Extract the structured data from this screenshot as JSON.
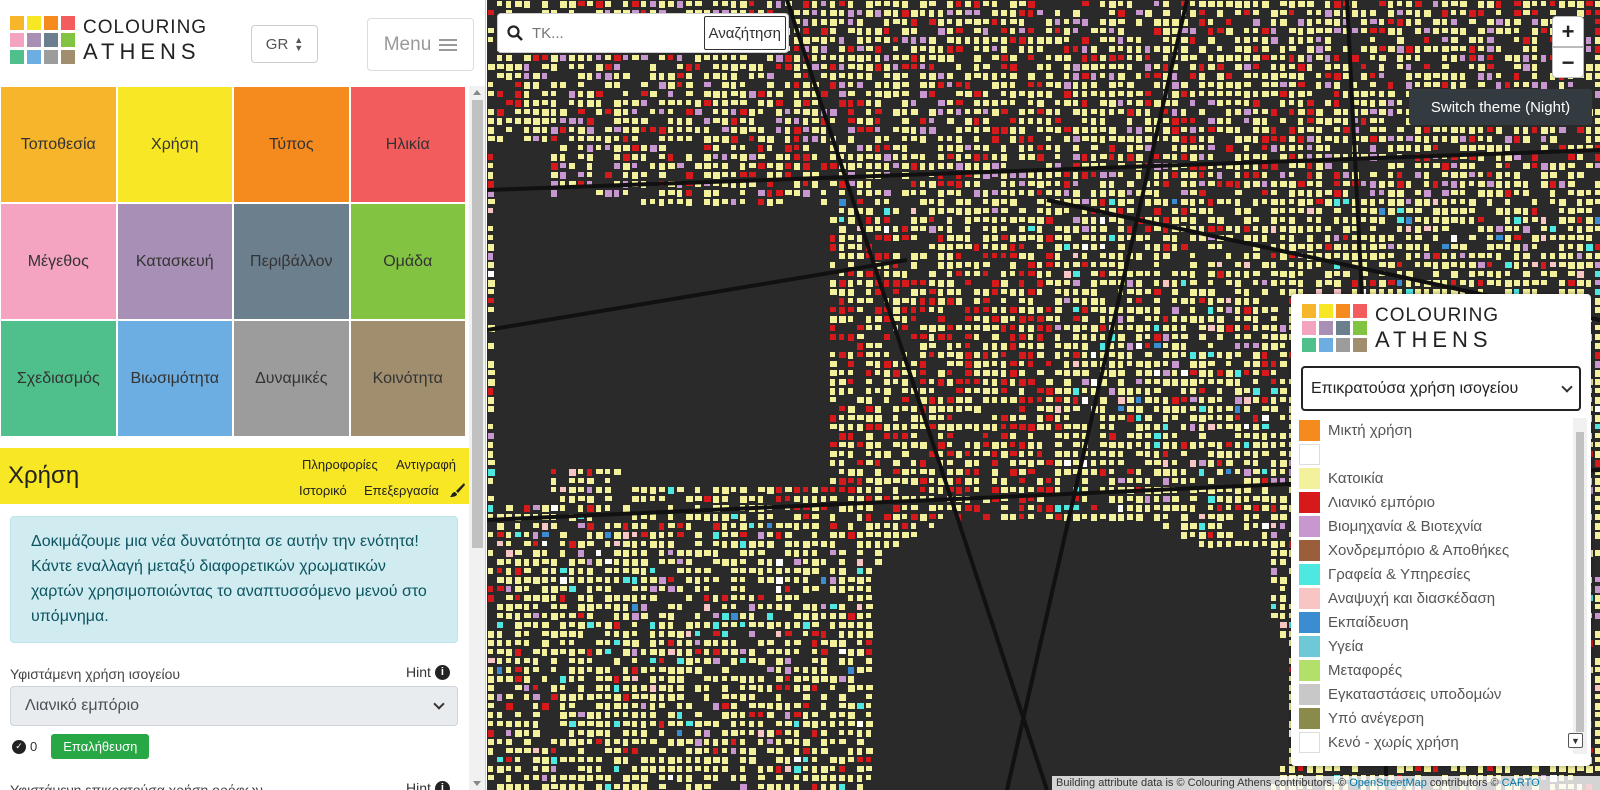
{
  "header": {
    "logo_line1": "COLOURING",
    "logo_line2": "ATHENS",
    "logo_colors": [
      "#f6b52a",
      "#f8e725",
      "#f58a1f",
      "#f25c5c",
      "#f4a3c1",
      "#a78fb5",
      "#6c7f8d",
      "#82c341",
      "#4fbf8b",
      "#6daee2",
      "#9c9c9c",
      "#a08e6f"
    ],
    "language": "GR",
    "menu_label": "Menu"
  },
  "categories": [
    {
      "label": "Τοποθεσία",
      "color": "#f6b52a"
    },
    {
      "label": "Χρήση",
      "color": "#f8e725"
    },
    {
      "label": "Τύπος",
      "color": "#f58a1f"
    },
    {
      "label": "Ηλικία",
      "color": "#f25c5c"
    },
    {
      "label": "Μέγεθος",
      "color": "#f4a3c1"
    },
    {
      "label": "Κατασκευή",
      "color": "#a78fb5"
    },
    {
      "label": "Περιβάλλον",
      "color": "#6c7f8d"
    },
    {
      "label": "Ομάδα",
      "color": "#82c341"
    },
    {
      "label": "Σχεδιασμός",
      "color": "#4fbf8b"
    },
    {
      "label": "Βιωσιμότητα",
      "color": "#6daee2"
    },
    {
      "label": "Δυναμικές",
      "color": "#9c9c9c"
    },
    {
      "label": "Κοινότητα",
      "color": "#a08e6f"
    }
  ],
  "section": {
    "title": "Χρήση",
    "links": {
      "info": "Πληροφορίες",
      "copy": "Αντιγραφή",
      "history": "Ιστορικό",
      "edit": "Επεξεργασία"
    }
  },
  "notice": "Δοκιμάζουμε μια νέα δυνατότητα σε αυτήν την ενότητα! Κάντε εναλλαγή μεταξύ διαφορετικών χρωματικών χαρτών χρησιμοποιώντας το αναπτυσσόμενο μενού στο υπόμνημα.",
  "ground_floor": {
    "label": "Υφιστάμενη χρήση ισογείου",
    "hint": "Hint",
    "value": "Λιανικό εμπόριο",
    "verify_count": "0",
    "verify_label": "Επαλήθευση"
  },
  "next_field": {
    "label": "Υφιστάμενη επικρατούσα χρήση ορόφων",
    "hint": "Hint"
  },
  "map": {
    "search_placeholder": "ΤΚ...",
    "search_button": "Αναζήτηση",
    "zoom_in": "+",
    "zoom_out": "−",
    "theme_tip": "Switch theme (Night)"
  },
  "legend": {
    "logo_line1": "COLOURING",
    "logo_line2": "ATHENS",
    "selected": "Επικρατούσα χρήση ισογείου",
    "items": [
      {
        "label": "Μικτή χρήση",
        "color": "#f58a1f"
      },
      {
        "label": "",
        "color": "#ffffff"
      },
      {
        "label": "Κατοικία",
        "color": "#f3f19b"
      },
      {
        "label": "Λιανικό εμπόριο",
        "color": "#d7191c"
      },
      {
        "label": "Βιομηχανία & Βιοτεχνία",
        "color": "#c997d0"
      },
      {
        "label": "Χονδρεμπόριο & Αποθήκες",
        "color": "#9a5e3a"
      },
      {
        "label": "Γραφεία & Υπηρεσίες",
        "color": "#4fe8e0"
      },
      {
        "label": "Αναψυχή και διασκέδαση",
        "color": "#f9c4c4"
      },
      {
        "label": "Εκπαίδευση",
        "color": "#3b8dd2"
      },
      {
        "label": "Υγεία",
        "color": "#6dc9d6"
      },
      {
        "label": "Μεταφορές",
        "color": "#b2e06a"
      },
      {
        "label": "Εγκαταστάσεις υποδομών",
        "color": "#c8c8c8"
      },
      {
        "label": "Υπό ανέγερση",
        "color": "#8a8a4a"
      },
      {
        "label": "Κενό - χωρίς χρήση",
        "color": "#ffffff"
      }
    ]
  },
  "attribution": {
    "text1": "Building attribute data is © Colouring Athens contributors. © ",
    "osm": "OpenStreetMap",
    "text2": " contributors © ",
    "carto": "CARTO"
  }
}
